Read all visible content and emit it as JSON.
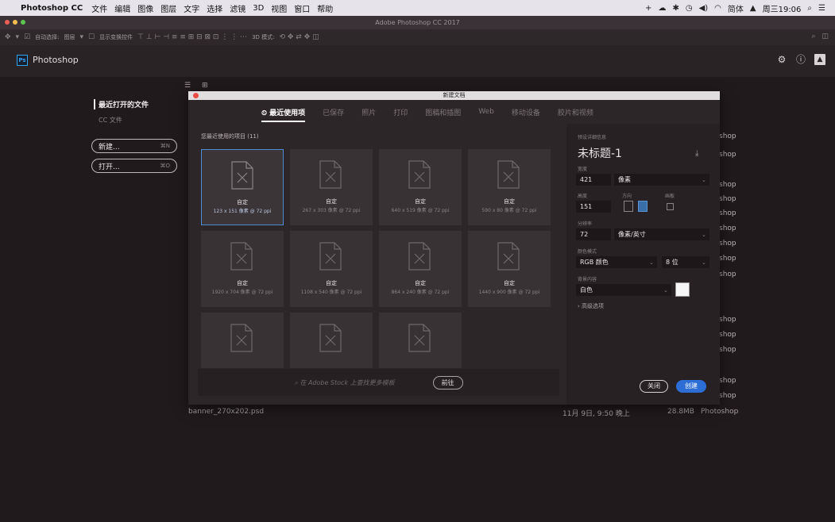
{
  "menubar": {
    "app": "Photoshop CC",
    "items": [
      "文件",
      "编辑",
      "图像",
      "图层",
      "文字",
      "选择",
      "滤镜",
      "3D",
      "视图",
      "窗口",
      "帮助"
    ],
    "clock": "周三19:06",
    "input_label": "简体"
  },
  "window_title": "Adobe Photoshop CC 2017",
  "options_bar": {
    "auto_select": "自动选择:",
    "layer": "图层",
    "show_transform": "显示变换控件",
    "mode3d": "3D 模式:"
  },
  "app_header": {
    "logo": "Ps",
    "name": "Photoshop"
  },
  "start": {
    "recent_title": "最近打开的文件",
    "cc_files": "CC 文件",
    "new_button": "新建...",
    "new_shortcut": "⌘N",
    "open_button": "打开...",
    "open_shortcut": "⌘O",
    "bg_labels": [
      "shop",
      "shop",
      "shop",
      "shop",
      "shop",
      "shop",
      "shop",
      "shop",
      "shop",
      "shop",
      "shop",
      "shop",
      "shop"
    ],
    "file_name": "banner_270x202.psd",
    "file_date": "11月 9日, 9:50 晚上",
    "file_size": "28.8MB",
    "file_app": "Photoshop"
  },
  "dialog": {
    "title": "新建文档",
    "tabs": [
      "最近使用项",
      "已保存",
      "照片",
      "打印",
      "图稿和插图",
      "Web",
      "移动设备",
      "胶片和视频"
    ],
    "recent_label": "您最近使用的项目 (11)",
    "tiles": [
      {
        "name": "自定",
        "size": "123 x 151 像素 @ 72 ppi"
      },
      {
        "name": "自定",
        "size": "267 x 303 像素 @ 72 ppi"
      },
      {
        "name": "自定",
        "size": "640 x 519 像素 @ 72 ppi"
      },
      {
        "name": "自定",
        "size": "590 x 80 像素 @ 72 ppi"
      },
      {
        "name": "自定",
        "size": "1920 x 704 像素 @ 72 ppi"
      },
      {
        "name": "自定",
        "size": "1108 x 540 像素 @ 72 ppi"
      },
      {
        "name": "自定",
        "size": "864 x 240 像素 @ 72 ppi"
      },
      {
        "name": "自定",
        "size": "1440 x 900 像素 @ 72 ppi"
      },
      {
        "name": "",
        "size": ""
      },
      {
        "name": "",
        "size": ""
      },
      {
        "name": "",
        "size": ""
      }
    ],
    "search_placeholder": "在 Adobe Stock 上查找更多模板",
    "go_button": "前往",
    "details": {
      "preset_label": "预设详细信息",
      "doc_name": "未标题-1",
      "width_label": "宽度",
      "width_value": "421",
      "width_unit": "像素",
      "height_label": "高度",
      "height_value": "151",
      "orient_label": "方向",
      "artboard_label": "画板",
      "resolution_label": "分辨率",
      "resolution_value": "72",
      "resolution_unit": "像素/英寸",
      "color_label": "颜色模式",
      "color_value": "RGB 颜色",
      "bit_value": "8 位",
      "bg_label": "背景内容",
      "bg_value": "白色",
      "advanced": "› 高级选项",
      "close_button": "关闭",
      "create_button": "创建"
    }
  }
}
